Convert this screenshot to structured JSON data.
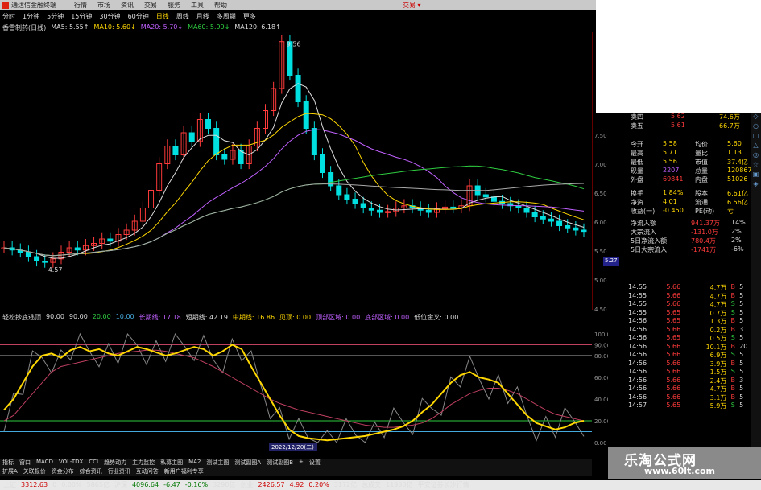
{
  "titlebar": {
    "title": "通达信金融终端",
    "menu": [
      "行情",
      "市场",
      "资讯",
      "交易",
      "服务",
      "工具",
      "帮助"
    ],
    "right": "交易 ▾"
  },
  "tabs": [
    "分时",
    "1分钟",
    "5分钟",
    "15分钟",
    "30分钟",
    "60分钟",
    "日线",
    "周线",
    "月线",
    "多周期",
    "更多"
  ],
  "active_tab": "日线",
  "ma_legend": [
    {
      "text": "香雪制药(日线)",
      "color": "#ddd"
    },
    {
      "text": "MA5: 5.55↑",
      "color": "#ddd"
    },
    {
      "text": "MA10: 5.60↓",
      "color": "#ffd700"
    },
    {
      "text": "MA20: 5.70↓",
      "color": "#c060ff"
    },
    {
      "text": "MA60: 5.99↓",
      "color": "#2ecc40"
    },
    {
      "text": "MA120: 6.18↑",
      "color": "#ddd"
    }
  ],
  "main_chart": {
    "high_label": "9.56",
    "low_label": "4.57",
    "axis": [
      "7.50",
      "7.00",
      "6.50",
      "6.00",
      "5.50",
      "5.00",
      "4.50"
    ],
    "price_tag": "5.27"
  },
  "ind_legend": [
    {
      "text": "轻松抄底逃顶",
      "color": "#ddd"
    },
    {
      "text": "90.00",
      "color": "#ddd"
    },
    {
      "text": "90.00",
      "color": "#ddd"
    },
    {
      "text": "20.00",
      "color": "#2ecc40"
    },
    {
      "text": "10.00",
      "color": "#4ad"
    },
    {
      "text": "长期线: 17.18",
      "color": "#c060ff"
    },
    {
      "text": "短期线: 42.19",
      "color": "#ddd"
    },
    {
      "text": "中期线: 16.86",
      "color": "#ffd700"
    },
    {
      "text": "见顶: 0.00",
      "color": "#ffd700"
    },
    {
      "text": "顶部区域: 0.00",
      "color": "#c060ff"
    },
    {
      "text": "底部区域: 0.00",
      "color": "#c060ff"
    },
    {
      "text": "低位金叉: 0.00",
      "color": "#ddd"
    }
  ],
  "ind_axis": [
    "100.0",
    "90.00",
    "80.00",
    "60.00",
    "40.00",
    "20.00",
    "0.00"
  ],
  "date_label": "2022/12/20(二)",
  "bottom_tabs": [
    "指标",
    "窗口",
    "MACD",
    "VOL-TDX",
    "CCI",
    "趋势动力",
    "主力监控",
    "私募主图",
    "MA2",
    "测试主图",
    "测试副图A",
    "测试副图B",
    "+",
    "设置"
  ],
  "bottom_tabs2": [
    "扩展A",
    "关联报价",
    "资金分布",
    "综合资讯",
    "行业资讯",
    "互动问答",
    "新用户福利专享"
  ],
  "ticker": [
    {
      "label": "上证",
      "cls": "wht"
    },
    {
      "label": "3312.63",
      "cls": "up"
    },
    {
      "label": "0",
      "cls": "wht"
    },
    {
      "label": "0.00%",
      "cls": "wht"
    },
    {
      "label": "5865亿",
      "cls": "wht"
    },
    {
      "label": "沪深",
      "cls": "wht"
    },
    {
      "label": "4096.64",
      "cls": "dn"
    },
    {
      "label": "-6.47",
      "cls": "dn"
    },
    {
      "label": "-0.16%",
      "cls": "dn"
    },
    {
      "label": "3290亿",
      "cls": "wht"
    },
    {
      "label": "创业",
      "cls": "wht"
    },
    {
      "label": "2426.57",
      "cls": "up"
    },
    {
      "label": "4.92",
      "cls": "up"
    },
    {
      "label": "0.20%",
      "cls": "up"
    },
    {
      "label": "3172亿",
      "cls": "wht"
    },
    {
      "label": "总成交",
      "cls": "wht"
    },
    {
      "label": "11933亿",
      "cls": "wht"
    },
    {
      "label": "平安证券长沙行情",
      "cls": "wht"
    }
  ],
  "quote": {
    "asks": [
      [
        "卖四",
        "5.62",
        "74.6万"
      ],
      [
        "卖五",
        "5.61",
        "66.7万"
      ]
    ],
    "stats": [
      [
        "今开",
        "5.58",
        "均价",
        "5.60"
      ],
      [
        "最高",
        "5.71",
        "量比",
        "1.13"
      ],
      [
        "最低",
        "5.56",
        "市值",
        "37.4亿"
      ],
      [
        "现量",
        "2207",
        "总量",
        "120867"
      ],
      [
        "外盘",
        "69841",
        "内盘",
        "51026"
      ],
      [
        "换手",
        "1.84%",
        "股本",
        "6.61亿"
      ],
      [
        "净资",
        "4.01",
        "流通",
        "6.56亿"
      ],
      [
        "收益(一)",
        "-0.450",
        "PE(动)",
        "亏"
      ]
    ],
    "flows": [
      [
        "净流入额",
        "941.37万",
        "14%"
      ],
      [
        "大宗流入",
        "-131.0万",
        "2%"
      ],
      [
        "5日净流入额",
        "780.4万",
        "2%"
      ],
      [
        "5日大宗流入",
        "-1741万",
        "-6%"
      ]
    ]
  },
  "ticks": [
    [
      "14:55",
      "5.66",
      "4.7万",
      "B",
      "5"
    ],
    [
      "14:55",
      "5.66",
      "4.7万",
      "B",
      "5"
    ],
    [
      "14:55",
      "5.66",
      "4.7万",
      "S",
      "5"
    ],
    [
      "14:55",
      "5.65",
      "0.7万",
      "S",
      "5"
    ],
    [
      "14:56",
      "5.65",
      "1.3万",
      "B",
      "5"
    ],
    [
      "14:56",
      "5.66",
      "0.2万",
      "B",
      "3"
    ],
    [
      "14:56",
      "5.65",
      "0.5万",
      "S",
      "5"
    ],
    [
      "14:56",
      "5.66",
      "10.1万",
      "B",
      "20"
    ],
    [
      "14:56",
      "5.66",
      "6.9万",
      "S",
      "5"
    ],
    [
      "14:56",
      "5.66",
      "3.9万",
      "B",
      "5"
    ],
    [
      "14:56",
      "5.66",
      "1.5万",
      "S",
      "5"
    ],
    [
      "14:56",
      "5.66",
      "2.4万",
      "B",
      "3"
    ],
    [
      "14:56",
      "5.66",
      "4.7万",
      "B",
      "5"
    ],
    [
      "14:56",
      "5.66",
      "3.1万",
      "B",
      "5"
    ],
    [
      "14:57",
      "5.65",
      "5.9万",
      "S",
      "5"
    ]
  ],
  "watermark": {
    "big": "乐淘公式网",
    "small": "www.60lt.com"
  },
  "colors": {
    "ma5": "#dddddd",
    "ma10": "#ffd700",
    "ma20": "#c060ff",
    "ma60": "#2ecc40",
    "ma120": "#aaaaaa",
    "up": "#ff3b3b",
    "down": "#00e0e0"
  }
}
